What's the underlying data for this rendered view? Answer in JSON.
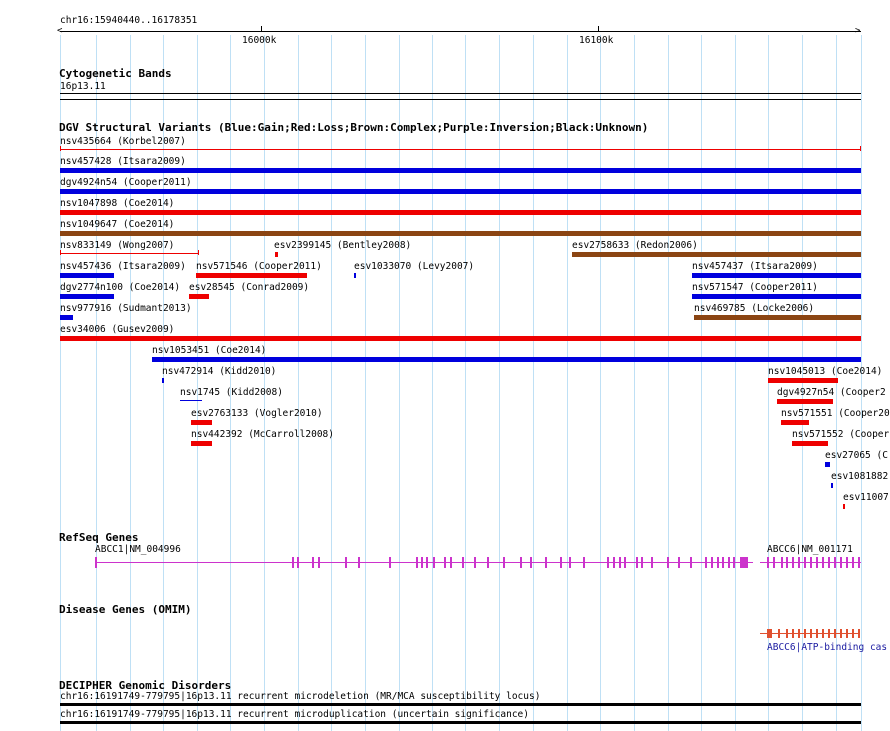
{
  "ruler": {
    "region": "chr16:15940440..16178351",
    "ticks": [
      {
        "label": "16000k",
        "pos": 16000000
      },
      {
        "label": "16100k",
        "pos": 16100000
      }
    ],
    "start": 15940440,
    "end": 16178351
  },
  "cytoband": {
    "title": "Cytogenetic Bands",
    "band": "16p13.11"
  },
  "dgv": {
    "title": "DGV Structural Variants (Blue:Gain;Red:Loss;Brown:Complex;Purple:Inversion;Black:Unknown)",
    "colors": {
      "gain": "#0000dd",
      "loss": "#ee0000",
      "complex": "#8b4513"
    },
    "variants": [
      {
        "label": "nsv435664 (Korbel2007)",
        "type": "loss",
        "thin": true
      },
      {
        "label": "nsv457428 (Itsara2009)",
        "type": "gain"
      },
      {
        "label": "dgv4924n54 (Cooper2011)",
        "type": "gain"
      },
      {
        "label": "nsv1047898 (Coe2014)",
        "type": "loss"
      },
      {
        "label": "nsv1049647 (Coe2014)",
        "type": "complex"
      },
      {
        "label": "nsv833149 (Wong2007)",
        "type": "loss",
        "thin": true
      },
      {
        "label": "esv2399145 (Bentley2008)",
        "type": "loss"
      },
      {
        "label": "esv2758633 (Redon2006)",
        "type": "complex"
      },
      {
        "label": "nsv457436 (Itsara2009)",
        "type": "gain"
      },
      {
        "label": "nsv571546 (Cooper2011)",
        "type": "loss"
      },
      {
        "label": "esv1033070 (Levy2007)",
        "type": "gain"
      },
      {
        "label": "nsv457437 (Itsara2009)",
        "type": "gain"
      },
      {
        "label": "dgv2774n100 (Coe2014)",
        "type": "gain"
      },
      {
        "label": "esv28545 (Conrad2009)",
        "type": "loss"
      },
      {
        "label": "nsv571547 (Cooper2011)",
        "type": "gain"
      },
      {
        "label": "nsv977916 (Sudmant2013)",
        "type": "gain"
      },
      {
        "label": "nsv469785 (Locke2006)",
        "type": "complex"
      },
      {
        "label": "esv34006 (Gusev2009)",
        "type": "loss"
      },
      {
        "label": "nsv1053451 (Coe2014)",
        "type": "gain"
      },
      {
        "label": "nsv472914 (Kidd2010)",
        "type": "gain"
      },
      {
        "label": "nsv1045013 (Coe2014)",
        "type": "loss"
      },
      {
        "label": "nsv1745 (Kidd2008)",
        "type": "gain"
      },
      {
        "label": "dgv4927n54 (Cooper2",
        "type": "loss"
      },
      {
        "label": "esv2763133 (Vogler2010)",
        "type": "loss"
      },
      {
        "label": "nsv571551 (Cooper20",
        "type": "loss"
      },
      {
        "label": "nsv442392 (McCarroll2008)",
        "type": "loss"
      },
      {
        "label": "nsv571552 (Cooper",
        "type": "loss"
      },
      {
        "label": "esv27065 (C",
        "type": "gain"
      },
      {
        "label": "esv1081882",
        "type": "gain"
      },
      {
        "label": "esv11007",
        "type": "loss"
      }
    ]
  },
  "refseq": {
    "title": "RefSeq Genes",
    "genes": [
      {
        "label": "ABCC1|NM_004996"
      },
      {
        "label": "ABCC6|NM_001171"
      }
    ]
  },
  "omim": {
    "title": "Disease Genes (OMIM)",
    "genes": [
      {
        "label": "ABCC6|ATP-binding cas"
      }
    ]
  },
  "decipher": {
    "title": "DECIPHER Genomic Disorders",
    "items": [
      {
        "label": "chr16:16191749-779795|16p13.11 recurrent microdeletion (MR/MCA susceptibility locus)"
      },
      {
        "label": "chr16:16191749-779795|16p13.11 recurrent microduplication (uncertain significance)"
      }
    ]
  }
}
